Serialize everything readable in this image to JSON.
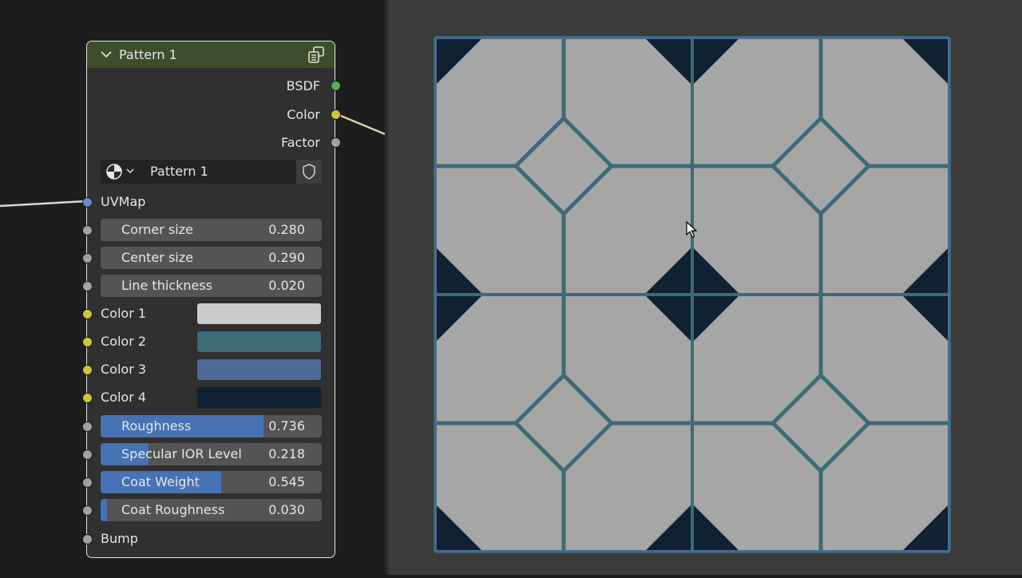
{
  "node": {
    "title": "Pattern 1",
    "outputs": [
      {
        "label": "BSDF",
        "socket": "green"
      },
      {
        "label": "Color",
        "socket": "yellow"
      },
      {
        "label": "Factor",
        "socket": "gray"
      }
    ],
    "datablock": {
      "name": "Pattern 1",
      "icon": "material-icon",
      "action_icon": "shield-icon"
    },
    "inputs": {
      "uvmap": {
        "label": "UVMap"
      },
      "corner_size": {
        "label": "Corner size",
        "value": "0.280"
      },
      "center_size": {
        "label": "Center size",
        "value": "0.290"
      },
      "line_thickness": {
        "label": "Line thickness",
        "value": "0.020"
      },
      "color1": {
        "label": "Color 1",
        "color": "#cccccc"
      },
      "color2": {
        "label": "Color 2",
        "color": "#3c6b76"
      },
      "color3": {
        "label": "Color 3",
        "color": "#4f6a96"
      },
      "color4": {
        "label": "Color 4",
        "color": "#102134"
      },
      "roughness": {
        "label": "Roughness",
        "value": "0.736",
        "fill": 0.736
      },
      "specular": {
        "label": "Specular IOR Level",
        "value": "0.218",
        "fill": 0.218
      },
      "coat_weight": {
        "label": "Coat Weight",
        "value": "0.545",
        "fill": 0.545
      },
      "coat_roughness": {
        "label": "Coat Roughness",
        "value": "0.030",
        "fill": 0.03
      },
      "bump": {
        "label": "Bump"
      }
    }
  },
  "preview": {
    "tile_light": "#a6a6a6",
    "grout": "#3c6b76",
    "corner_dark": "#102134",
    "edge_blue": "#4f6a96"
  }
}
